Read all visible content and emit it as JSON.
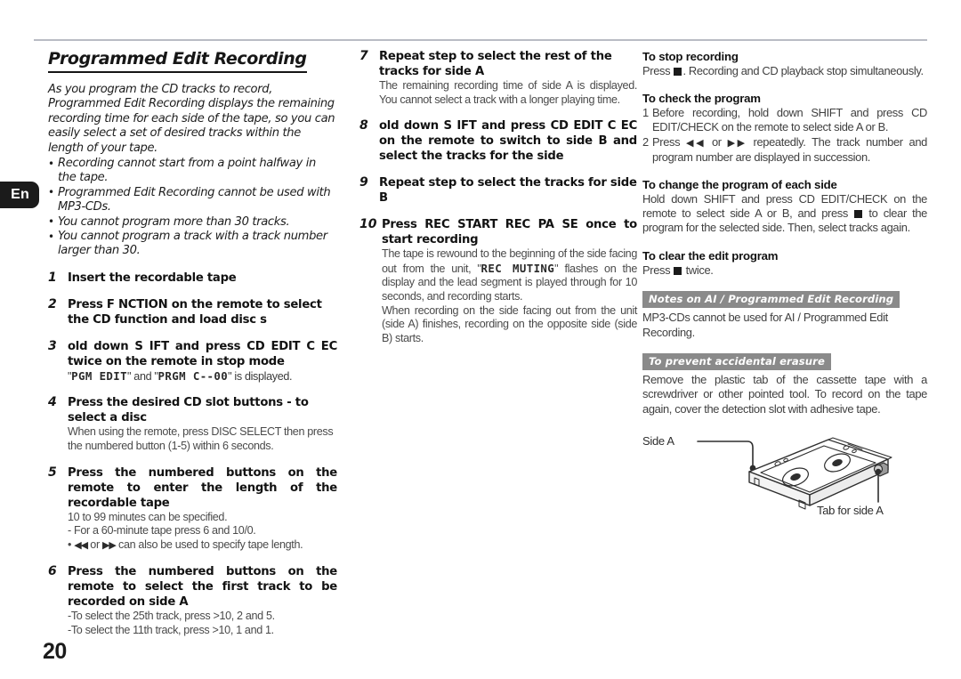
{
  "page": {
    "number": "20",
    "language_tab": "En"
  },
  "left_column": {
    "headline": "Programmed Edit Recording",
    "intro": "As you program the CD tracks to record, Programmed Edit Recording displays the remaining recording time for each side of the tape, so you can easily select a set of desired tracks within the length of your tape.",
    "bullets": [
      "Recording cannot start from a point halfway in the tape.",
      "Programmed Edit Recording cannot be used with MP3-CDs.",
      "You cannot program more than 30 tracks.",
      "You cannot program a track with a track number larger than 30."
    ],
    "steps": [
      {
        "num": "1",
        "title": "Insert the recordable tape",
        "sub": ""
      },
      {
        "num": "2",
        "title": "Press F NCTION on the remote to select the CD function  and load disc s",
        "sub": ""
      },
      {
        "num": "3",
        "title": " old down S IFT and press CD EDIT C EC twice on the remote in stop mode",
        "sub_lcd_1": "PGM EDIT",
        "sub_mid": " and ",
        "sub_lcd_2": "PRGM C--00",
        "sub_end": " is displayed."
      },
      {
        "num": "4",
        "title": "Press the desired CD slot buttons   -   to select a disc",
        "sub": "When using the remote, press DISC SELECT then press the numbered button (1-5) within 6 seconds."
      },
      {
        "num": "5",
        "title": "Press the numbered buttons on the remote to enter the length of the recordable tape",
        "sub_line1": "10 to 99 minutes can be specified.",
        "sub_line2": "-  For a 60-minute tape press 6 and 10/0.",
        "sub_line3_pre": "• ",
        "sub_line3_rew": "◀◀",
        "sub_line3_mid": " or ",
        "sub_line3_ff": "▶▶",
        "sub_line3_post": " can also be used to specify tape length."
      },
      {
        "num": "6",
        "title": "Press the numbered buttons on the remote to select the first track to be recorded on side A",
        "sub_line1": "-To select the 25th track, press >10, 2 and 5.",
        "sub_line2": "-To select the 11th track, press >10, 1 and 1."
      }
    ]
  },
  "middle_column": {
    "steps": [
      {
        "num": "7",
        "title": "Repeat step   to select the rest of the tracks for side A",
        "sub": "The remaining recording time of side A is displayed. You cannot select a track with a longer playing time."
      },
      {
        "num": "8",
        "title": " old down S IFT and press CD EDIT  C EC  on the remote to switch to side B and select the tracks for the side",
        "sub": ""
      },
      {
        "num": "9",
        "title": "Repeat step   to select the tracks for side B",
        "sub": ""
      },
      {
        "num": "10",
        "title": "Press  REC START  REC PA SE once to start recording",
        "sub_a_pre": "The tape is rewound to the beginning of the side facing out from the unit, \"",
        "sub_a_lcd": "REC MUTING",
        "sub_a_post": "\" flashes on the display and the lead segment is played through for 10 seconds, and recording starts.",
        "sub_b": "When recording on the side facing out from the unit (side A) finishes, recording on the opposite side (side B) starts."
      }
    ]
  },
  "right_column": {
    "stop_recording": {
      "heading": "To stop recording",
      "body_pre": "Press ",
      "body_post": ". Recording and CD playback stop simultaneously."
    },
    "check_program": {
      "heading": "To check the program",
      "items": [
        {
          "num": "1",
          "text": "Before recording, hold down SHIFT and press CD EDIT/CHECK on the remote to select side A or B."
        },
        {
          "num": "2",
          "text_pre": "Press ",
          "rew": "◀◀",
          "text_mid": " or ",
          "ff": "▶▶",
          "text_post": " repeatedly. The track number and program number are displayed in succession."
        }
      ]
    },
    "change_program": {
      "heading": "To change the program of each side",
      "body_pre": "Hold down SHIFT and press CD EDIT/CHECK on the remote to select side A or B, and press ",
      "body_post": " to clear the program for the selected side. Then, select tracks again."
    },
    "clear_program": {
      "heading": "To clear the edit program",
      "body_pre": "Press ",
      "body_post": " twice."
    },
    "notes_bar": {
      "label": "Notes on AI / Programmed Edit Recording",
      "body": "MP3-CDs cannot be used for AI / Programmed Edit Recording."
    },
    "erasure_bar": {
      "label": "To prevent accidental erasure",
      "body": "Remove the plastic tab of the cassette tape with a screwdriver or other pointed tool. To record on the tape again, cover the detection slot with adhesive tape."
    },
    "figure": {
      "label_side_a": "Side A",
      "label_tab": "Tab for side A"
    }
  },
  "colors": {
    "rule": "#b9bcc4",
    "bar_gray": "#8a8a8a",
    "ink": "#1b1b1b",
    "body_gray": "#3f3f3f"
  }
}
